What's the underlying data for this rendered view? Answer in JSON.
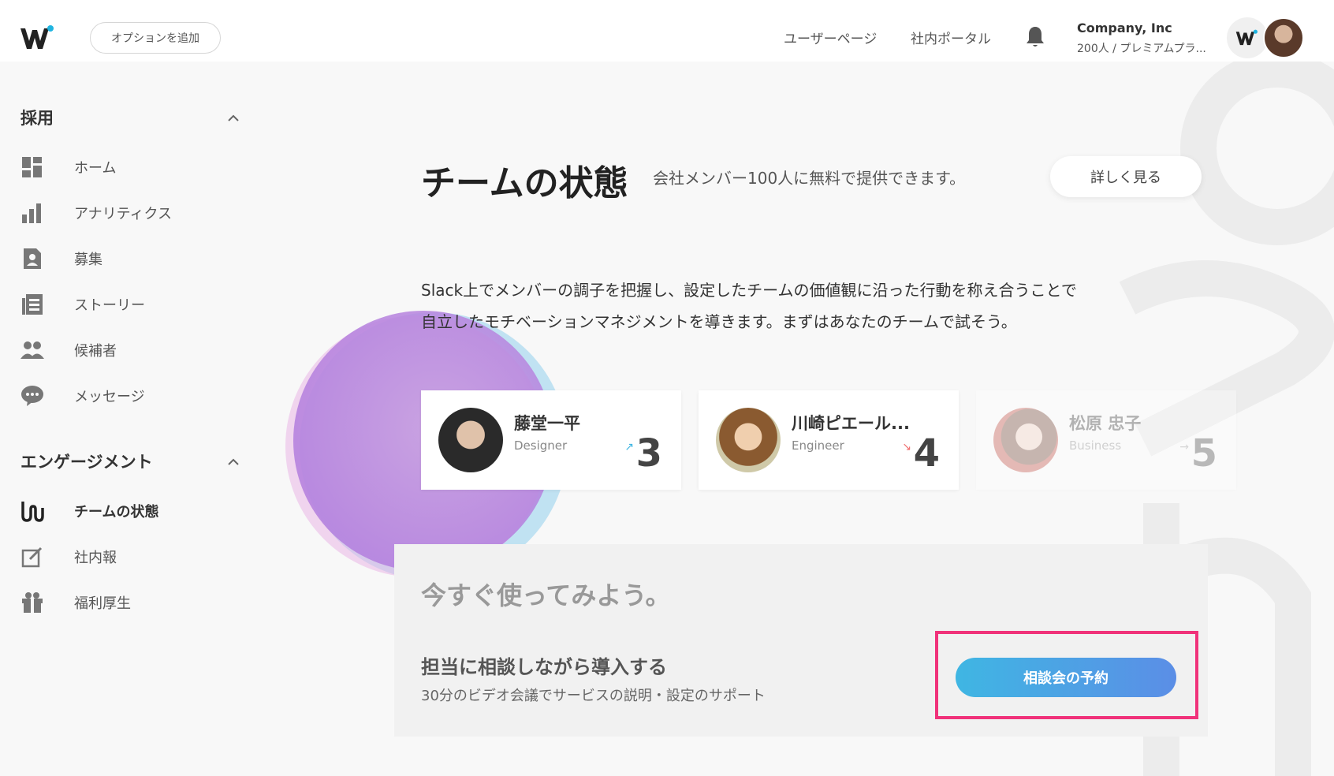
{
  "header": {
    "option_button": "オプションを追加",
    "nav": [
      "ユーザーページ",
      "社内ポータル"
    ],
    "company_name": "Company, Inc",
    "company_plan": "200人 / プレミアムプラ..."
  },
  "sidebar": {
    "sections": [
      {
        "title": "採用",
        "items": [
          {
            "label": "ホーム",
            "icon": "dashboard-icon"
          },
          {
            "label": "アナリティクス",
            "icon": "bar-chart-icon"
          },
          {
            "label": "募集",
            "icon": "job-posting-icon"
          },
          {
            "label": "ストーリー",
            "icon": "article-icon"
          },
          {
            "label": "候補者",
            "icon": "people-icon"
          },
          {
            "label": "メッセージ",
            "icon": "chat-icon"
          }
        ]
      },
      {
        "title": "エンゲージメント",
        "items": [
          {
            "label": "チームの状態",
            "icon": "team-wave-icon",
            "active": true
          },
          {
            "label": "社内報",
            "icon": "edit-note-icon"
          },
          {
            "label": "福利厚生",
            "icon": "gift-icon"
          }
        ]
      }
    ]
  },
  "main": {
    "title": "チームの状態",
    "subtitle": "会社メンバー100人に無料で提供できます。",
    "detail_button": "詳しく見る",
    "description_line1": "Slack上でメンバーの調子を把握し、設定したチームの価値観に沿った行動を称え合うことで",
    "description_line2": "自立したモチベーションマネジメントを導きます。まずはあなたのチームで試そう。",
    "cards": [
      {
        "name": "藤堂一平",
        "role": "Designer",
        "score": "3",
        "trend": "up",
        "arrow": "↗",
        "arrow_color": "#3fb6e3"
      },
      {
        "name": "川崎ピエール...",
        "role": "Engineer",
        "score": "4",
        "trend": "down",
        "arrow": "↘",
        "arrow_color": "#f07070"
      },
      {
        "name": "松原 忠子",
        "role": "Business",
        "score": "5",
        "trend": "right",
        "arrow": "→",
        "arrow_color": "#999999"
      }
    ],
    "try_title": "今すぐ使ってみよう。",
    "consult_title": "担当に相談しながら導入する",
    "consult_sub": "30分のビデオ会議でサービスの説明・設定のサポート",
    "reserve_button": "相談会の予約"
  },
  "colors": {
    "accent_blue": "#3fb6e3",
    "highlight_pink": "#f0327a"
  }
}
